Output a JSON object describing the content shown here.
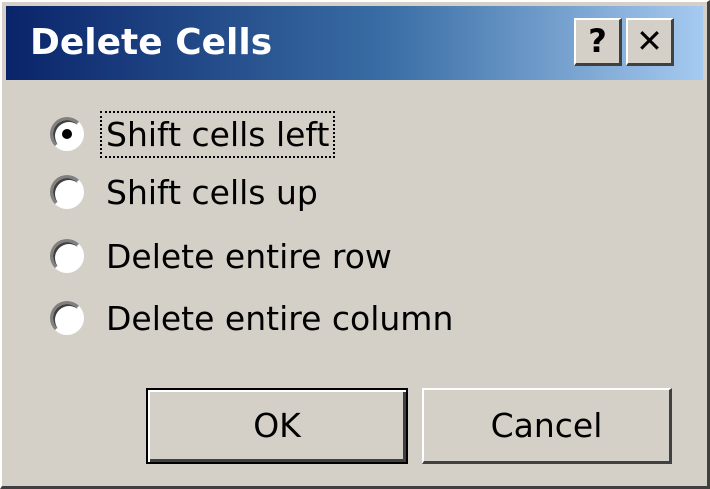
{
  "dialog": {
    "title": "Delete Cells",
    "help_label": "?",
    "close_label": "✕"
  },
  "options": [
    {
      "label": "Shift cells left",
      "checked": true
    },
    {
      "label": "Shift cells up",
      "checked": false
    },
    {
      "label": "Delete entire row",
      "checked": false
    },
    {
      "label": "Delete entire column",
      "checked": false
    }
  ],
  "buttons": {
    "ok_label": "OK",
    "cancel_label": "Cancel"
  },
  "colors": {
    "titlebar_start": "#0a246a",
    "titlebar_end": "#a6caf0",
    "face": "#d4d0c8"
  }
}
